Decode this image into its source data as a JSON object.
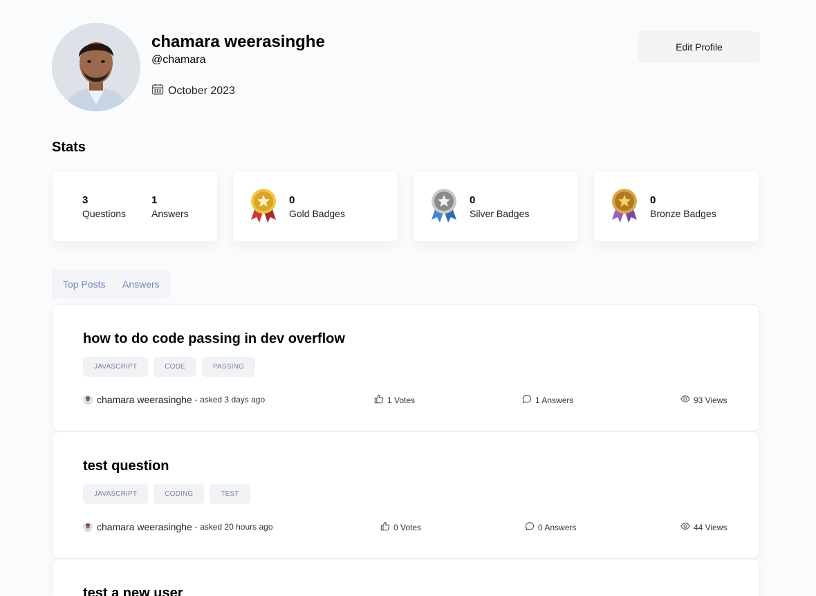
{
  "profile": {
    "name": "chamara weerasinghe",
    "username": "@chamara",
    "joined": "October 2023",
    "edit_label": "Edit Profile"
  },
  "stats": {
    "title": "Stats",
    "questions_count": "3",
    "questions_label": "Questions",
    "answers_count": "1",
    "answers_label": "Answers",
    "badges": [
      {
        "count": "0",
        "label": "Gold Badges",
        "icon": "gold-medal-icon",
        "color": "#e2b634"
      },
      {
        "count": "0",
        "label": "Silver Badges",
        "icon": "silver-medal-icon",
        "color": "#8c8c8c"
      },
      {
        "count": "0",
        "label": "Bronze Badges",
        "icon": "bronze-medal-icon",
        "color": "#c48f2c"
      }
    ]
  },
  "tabs": [
    {
      "label": "Top Posts"
    },
    {
      "label": "Answers"
    }
  ],
  "questions": [
    {
      "title": "how to do code passing in dev overflow",
      "tags": [
        "JAVASCRIPT",
        "CODE",
        "PASSING"
      ],
      "author": "chamara weerasinghe",
      "asked": "- asked 3 days ago",
      "votes": "1 Votes",
      "answers": "1 Answers",
      "views": "93 Views"
    },
    {
      "title": "test question",
      "tags": [
        "JAVASCRIPT",
        "CODING",
        "TEST"
      ],
      "author": "chamara weerasinghe",
      "asked": "- asked 20 hours ago",
      "votes": "0 Votes",
      "answers": "0 Answers",
      "views": "44 Views"
    },
    {
      "title": "test a new user"
    }
  ],
  "colors": {
    "accent_text": "#7a89b8",
    "tag_bg": "#f0f2f5",
    "card_bg": "#ffffff",
    "page_bg": "#fafbfc"
  }
}
